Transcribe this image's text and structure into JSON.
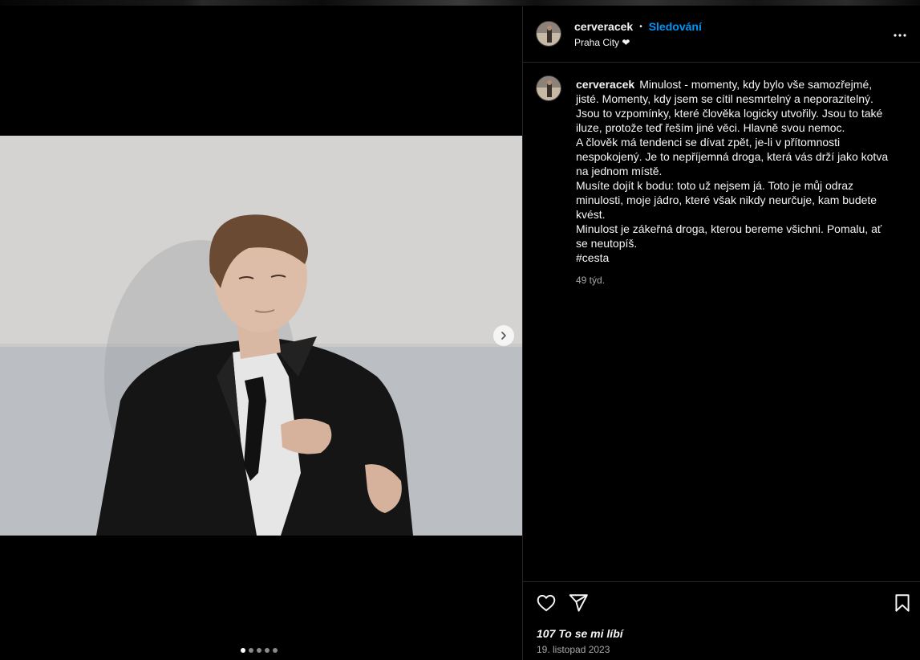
{
  "post": {
    "username": "cerveracek",
    "separator": "•",
    "follow_label": "Sledování",
    "location": "Praha City ❤"
  },
  "caption": {
    "username": "cerveracek",
    "lines": [
      "Minulost - momenty, kdy bylo vše samozřejmé, jisté. Momenty, kdy jsem se cítil nesmrtelný a neporazitelný. Jsou to vzpomínky, které člověka logicky utvořily. Jsou to také iluze, protože teď řeším jiné věci. Hlavně svou nemoc.",
      "A člověk má tendenci se dívat zpět, je-li v přítomnosti nespokojený. Je to nepříjemná droga, která vás drží jako kotva na jednom místě.",
      "Musíte dojít k bodu: toto už nejsem já. Toto je můj odraz minulosti, moje jádro, které však nikdy neurčuje, kam budete kvést.",
      "Minulost je zákeřná droga, kterou bereme všichni. Pomalu, ať se neutopíš.",
      "#cesta"
    ],
    "time_ago": "49 týd."
  },
  "engagement": {
    "likes_label": "107 To se mi líbí",
    "date": "19. listopad 2023"
  },
  "carousel": {
    "slide_count": 5,
    "active_index": 0
  },
  "icons": {
    "like": "heart-icon",
    "share": "send-icon",
    "save": "bookmark-icon",
    "more": "more-options-icon",
    "next": "chevron-right-icon"
  },
  "colors": {
    "follow_accent": "#0095f6",
    "background": "#000000",
    "divider": "#262626"
  }
}
